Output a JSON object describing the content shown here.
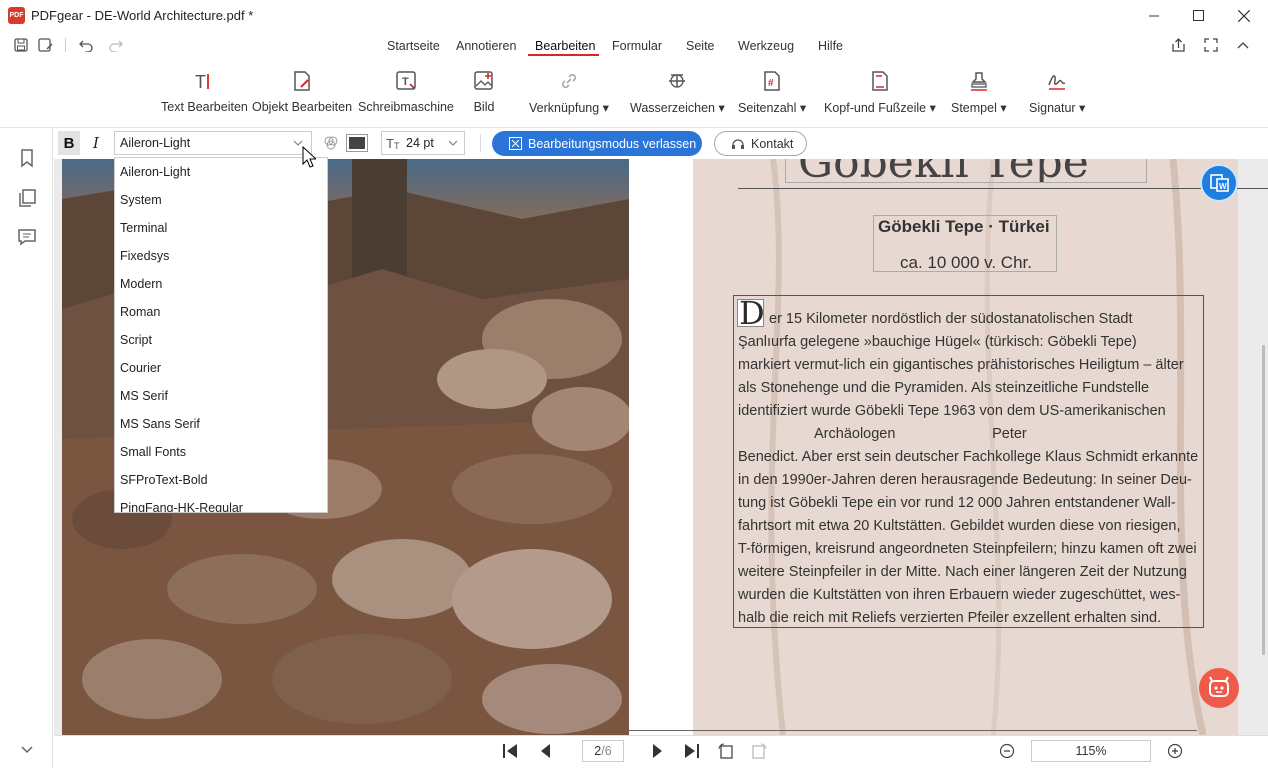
{
  "window": {
    "title": "PDFgear - DE-World Architecture.pdf *",
    "logo_text": "PDF"
  },
  "menu": {
    "items": [
      "Startseite",
      "Annotieren",
      "Bearbeiten",
      "Formular",
      "Seite",
      "Werkzeug",
      "Hilfe"
    ],
    "active": "Bearbeiten"
  },
  "ribbon": {
    "text_edit": "Text Bearbeiten",
    "object_edit": "Objekt Bearbeiten",
    "typewriter": "Schreibmaschine",
    "image": "Bild",
    "link": "Verknüpfung",
    "watermark": "Wasserzeichen",
    "page_number": "Seitenzahl",
    "header_footer": "Kopf-und Fußzeile",
    "stamp": "Stempel",
    "signature": "Signatur"
  },
  "format_toolbar": {
    "bold": "B",
    "italic": "I",
    "font": "Aileron-Light",
    "size": "24 pt",
    "text_color": "#444444",
    "exit_edit_mode": "Bearbeitungsmodus verlassen",
    "contact": "Kontakt"
  },
  "font_dropdown": [
    "Aileron-Light",
    "System",
    "Terminal",
    "Fixedsys",
    "Modern",
    "Roman",
    "Script",
    "Courier",
    "MS Serif",
    "MS Sans Serif",
    "Small Fonts",
    "SFProText-Bold",
    "PingFang-HK-Regular"
  ],
  "document": {
    "title_partial": "Göbekli Tepe",
    "subtitle": "Göbekli Tepe · Türkei",
    "date": "ca. 10 000 v. Chr.",
    "drop_cap": "D",
    "paragraph_lines": [
      "er 15 Kilometer nordöstlich der südostanatolischen Stadt",
      "Şanlıurfa gelegene »bauchige Hügel« (türkisch: Göbekli Tepe)",
      "markiert vermut-lich ein gigantisches prähistorisches Heiligtum – älter",
      "als Stonehenge und die Pyramiden. Als steinzeitliche Fundstelle",
      "identifiziert wurde Göbekli Tepe 1963 von dem US-amerikanischen",
      "Archäologen                        Peter",
      "Benedict. Aber erst sein deutscher Fachkollege Klaus Schmidt erkannte",
      "in den 1990er-Jahren deren herausragende Bedeutung: In seiner Deu-",
      "tung ist Göbekli Tepe ein vor rund 12 000 Jahren entstandener Wall-",
      "fahrtsort mit etwa 20 Kultstätten. Gebildet wurden diese von riesigen,",
      "T-förmigen, kreisrund angeordneten Steinpfeilern; hinzu kamen oft zwei",
      "weitere Steinpfeiler in der Mitte. Nach einer längeren Zeit der Nutzung",
      "wurden die Kultstätten von ihren Erbauern wieder zugeschüttet, wes-",
      "halb die reich mit Reliefs verzierten Pfeiler exzellent erhalten sind."
    ]
  },
  "status": {
    "page": "2",
    "total": "/6",
    "zoom": "115%"
  },
  "colors": {
    "accent": "#2b74d8",
    "active_underline": "#d9262b",
    "page_bg": "#e7d9d1"
  }
}
